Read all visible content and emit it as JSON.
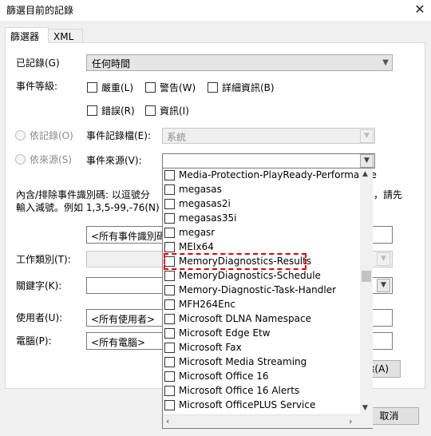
{
  "window": {
    "title": "篩選目前的記錄",
    "close": "✕"
  },
  "tabs": [
    {
      "label": "篩選器"
    },
    {
      "label": "XML"
    }
  ],
  "filter": {
    "logged_label": "已記錄(G)",
    "logged_value": "任何時間",
    "level_label": "事件等級:",
    "levels": [
      "嚴重(L)",
      "警告(W)",
      "詳細資訊(B)",
      "錯誤(R)",
      "資訊(I)"
    ],
    "by_log_label": "依記錄(O)",
    "by_source_label": "依來源(S)",
    "event_log_label": "事件記錄檔(E):",
    "event_log_value": "系統",
    "event_source_label": "事件來源(V):",
    "id_desc_line1": "內含/排除事件識別碼: 以逗號分",
    "id_desc_tail": "，請先",
    "id_desc_line2": "輸入減號。例如 1,3,5-99,-76(N)",
    "id_value": "<所有事件識別碼",
    "task_label": "工作類別(T):",
    "keyword_label": "關鍵字(K):",
    "user_label": "使用者(U):",
    "user_value": "<所有使用者>",
    "computer_label": "電腦(P):",
    "computer_value": "<所有電腦>",
    "clear_fragment": "徐(A)",
    "cancel_label": "取消"
  },
  "sources": [
    "Media-Protection-PlayReady-Performance",
    "megasas",
    "megasas2i",
    "megasas35i",
    "megasr",
    "MEIx64",
    "MemoryDiagnostics-Results",
    "MemoryDiagnostics-Schedule",
    "Memory-Diagnostic-Task-Handler",
    "MFH264Enc",
    "Microsoft DLNA Namespace",
    "Microsoft Edge Etw",
    "Microsoft Fax",
    "Microsoft Media Streaming",
    "Microsoft Office 16",
    "Microsoft Office 16 Alerts",
    "Microsoft OfficePLUS Service"
  ],
  "highlighted_source": "MemoryDiagnostics-Results",
  "icons": {
    "dropdown_arrow": "chevron-down-icon",
    "scroll_up": "chevron-up-icon",
    "scroll_down": "chevron-down-icon",
    "scroll_left": "chevron-left-icon",
    "scroll_right": "chevron-right-icon"
  },
  "colors": {
    "highlight": "#e60000",
    "panel": "#ffffff",
    "window": "#f0f0f0"
  }
}
